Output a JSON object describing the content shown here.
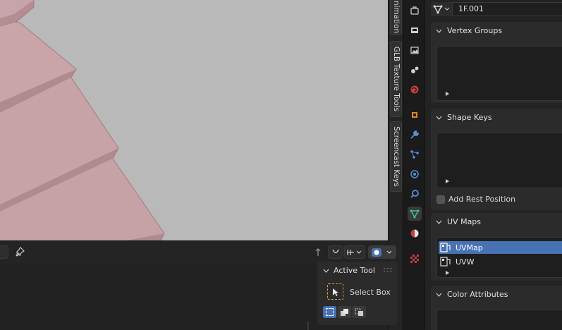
{
  "sidebar_tabs": [
    {
      "label": "nimation"
    },
    {
      "label": "GLB Texture Tools"
    },
    {
      "label": "Screencast Keys"
    }
  ],
  "mesh": {
    "name": "1F.001"
  },
  "panels": {
    "vertex_groups": {
      "title": "Vertex Groups"
    },
    "shape_keys": {
      "title": "Shape Keys",
      "add_rest_position": "Add Rest Position"
    },
    "uv_maps": {
      "title": "UV Maps",
      "items": [
        {
          "name": "UVMap",
          "selected": true
        },
        {
          "name": "UVW",
          "selected": false
        }
      ]
    },
    "color_attributes": {
      "title": "Color Attributes"
    }
  },
  "active_tool": {
    "title": "Active Tool",
    "tool_name": "Select Box"
  },
  "colors": {
    "viewport_bg": "#b9b9b9",
    "mesh_face": "#c6a3a8",
    "selection_blue": "#4772b3",
    "active_accent": "#f0a030"
  }
}
